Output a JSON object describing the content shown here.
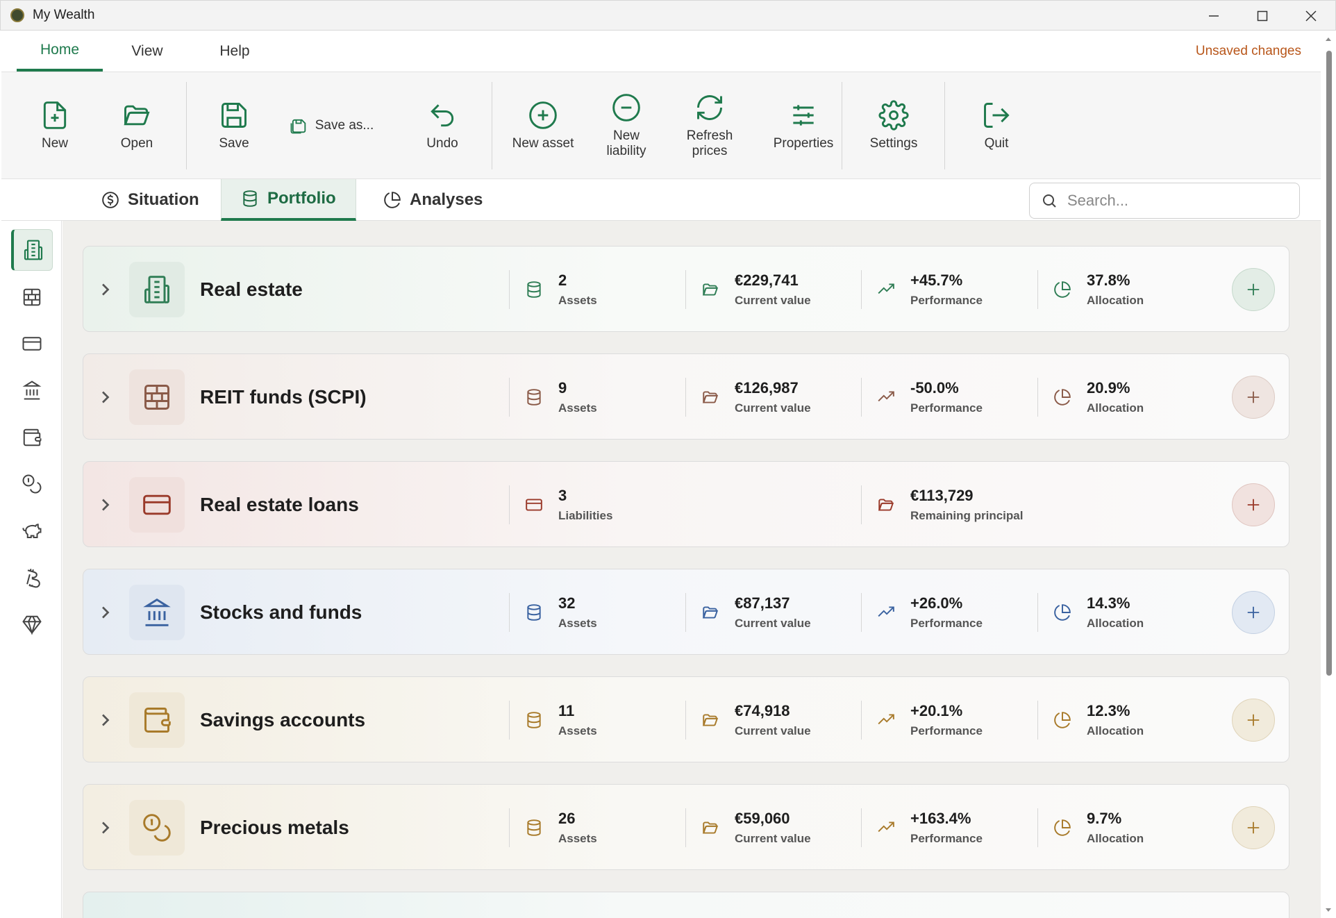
{
  "window": {
    "title": "My Wealth"
  },
  "menu": {
    "tabs": [
      {
        "label": "Home"
      },
      {
        "label": "View"
      },
      {
        "label": "Help"
      }
    ],
    "unsaved": "Unsaved changes"
  },
  "ribbon": {
    "new": "New",
    "open": "Open",
    "save": "Save",
    "save_as": "Save as...",
    "undo": "Undo",
    "new_asset": "New asset",
    "new_liability": "New liability",
    "refresh_prices": "Refresh prices",
    "properties": "Properties",
    "settings": "Settings",
    "quit": "Quit"
  },
  "subtabs": [
    {
      "label": "Situation"
    },
    {
      "label": "Portfolio"
    },
    {
      "label": "Analyses"
    }
  ],
  "search": {
    "placeholder": "Search..."
  },
  "sidebar": {
    "icons": [
      "building-icon",
      "brick-wall-icon",
      "credit-card-icon",
      "bank-icon",
      "wallet-icon",
      "coins-icon",
      "piggy-bank-icon",
      "bitcoin-icon",
      "gem-icon"
    ]
  },
  "categories": [
    {
      "name": "Real estate",
      "count": "2",
      "count_label": "Assets",
      "value": "€229,741",
      "value_label": "Current value",
      "perf": "+45.7%",
      "perf_label": "Performance",
      "alloc": "37.8%",
      "alloc_label": "Allocation",
      "color": "#2f7d55"
    },
    {
      "name": "REIT funds (SCPI)",
      "count": "9",
      "count_label": "Assets",
      "value": "€126,987",
      "value_label": "Current value",
      "perf": "-50.0%",
      "perf_label": "Performance",
      "alloc": "20.9%",
      "alloc_label": "Allocation",
      "color": "#8a5a48"
    },
    {
      "name": "Real estate loans",
      "count": "3",
      "count_label": "Liabilities",
      "value": "€113,729",
      "value_label": "Remaining principal",
      "color": "#9a3a2a"
    },
    {
      "name": "Stocks and funds",
      "count": "32",
      "count_label": "Assets",
      "value": "€87,137",
      "value_label": "Current value",
      "perf": "+26.0%",
      "perf_label": "Performance",
      "alloc": "14.3%",
      "alloc_label": "Allocation",
      "color": "#3a62a0"
    },
    {
      "name": "Savings accounts",
      "count": "11",
      "count_label": "Assets",
      "value": "€74,918",
      "value_label": "Current value",
      "perf": "+20.1%",
      "perf_label": "Performance",
      "alloc": "12.3%",
      "alloc_label": "Allocation",
      "color": "#a87a2a"
    },
    {
      "name": "Precious metals",
      "count": "26",
      "count_label": "Assets",
      "value": "€59,060",
      "value_label": "Current value",
      "perf": "+163.4%",
      "perf_label": "Performance",
      "alloc": "9.7%",
      "alloc_label": "Allocation",
      "color": "#a87a2a"
    }
  ],
  "colors": {
    "accent": "#1f7a4d",
    "warning": "#b8561a"
  }
}
